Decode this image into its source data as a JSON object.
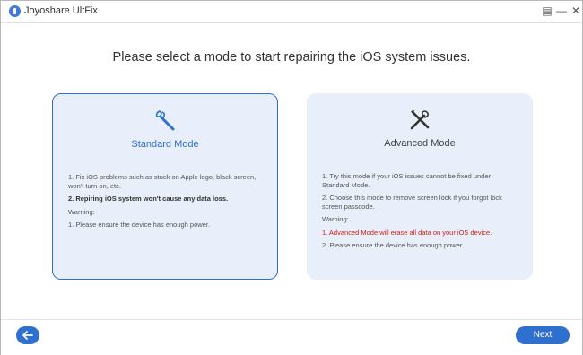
{
  "window": {
    "title": "Joyoshare UltFix",
    "menu_icon": "menu-icon",
    "minimize_icon": "minimize-icon",
    "close_icon": "close-icon"
  },
  "heading": "Please select a mode to start repairing the iOS system issues.",
  "modes": [
    {
      "title": "Standard Mode",
      "icon": "wrench-icon",
      "selected": true,
      "items": [
        "1. Fix iOS problems such as stuck on Apple logo, black screen, won't turn on, etc.",
        "2. Repiring iOS system won't cause any data loss."
      ],
      "warning_label": "Warning:",
      "warnings": [
        "1. Please ensure the device has enough power."
      ]
    },
    {
      "title": "Advanced Mode",
      "icon": "tools-icon",
      "selected": false,
      "items": [
        "1. Try this mode if your iOS issues cannot be fixed under Standard Mode.",
        "2. Choose this mode to remove screen lock if you forgot lock screen passcode."
      ],
      "warning_label": "Warning:",
      "warnings": [
        "1. Advanced Mode will erase all data on your iOS device.",
        "2. Please ensure the device has enough power."
      ]
    }
  ],
  "footer": {
    "back_icon": "arrow-left-icon",
    "next_label": "Next"
  },
  "colors": {
    "accent": "#2f6fce",
    "card_bg": "#e8effa",
    "warning": "#d01b1b"
  }
}
